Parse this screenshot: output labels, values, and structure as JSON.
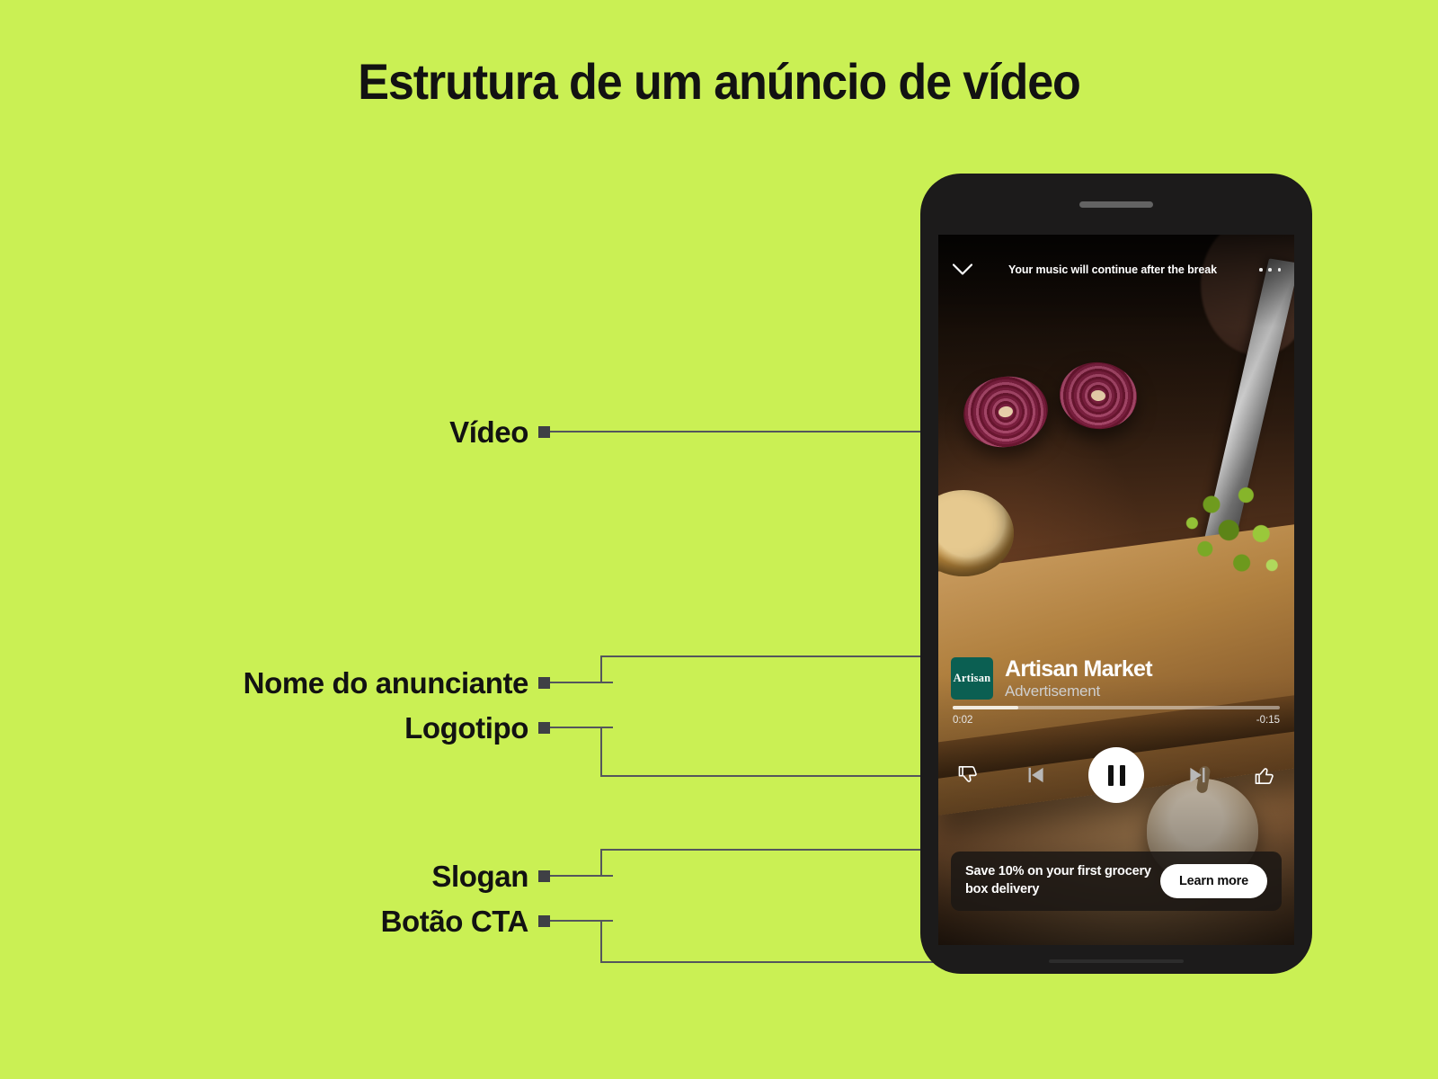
{
  "page": {
    "title": "Estrutura de um anúncio de vídeo",
    "background_color": "#caf054",
    "text_color": "#121212"
  },
  "callouts": [
    {
      "id": "video",
      "label": "Vídeo"
    },
    {
      "id": "advertiser",
      "label": "Nome do anunciante"
    },
    {
      "id": "logo",
      "label": "Logotipo"
    },
    {
      "id": "slogan",
      "label": "Slogan"
    },
    {
      "id": "cta",
      "label": "Botão CTA"
    }
  ],
  "phone": {
    "player": {
      "top_bar": {
        "collapse_icon": "chevron-down-icon",
        "message": "Your music will continue after the break",
        "overflow_icon": "more-options-icon"
      },
      "ad": {
        "logo_text": "Artisan",
        "logo_color": "#0b5f52",
        "advertiser_name": "Artisan Market",
        "label": "Advertisement"
      },
      "progress": {
        "elapsed": "0:02",
        "remaining": "-0:15",
        "percent": 20
      },
      "controls": [
        {
          "name": "thumbs-down-icon",
          "label": "Dislike"
        },
        {
          "name": "skip-previous-icon",
          "label": "Previous"
        },
        {
          "name": "pause-icon",
          "label": "Pause"
        },
        {
          "name": "skip-next-icon",
          "label": "Next"
        },
        {
          "name": "thumbs-up-icon",
          "label": "Like"
        }
      ],
      "cta": {
        "slogan": "Save 10% on your first grocery box delivery",
        "button_label": "Learn more"
      }
    }
  }
}
